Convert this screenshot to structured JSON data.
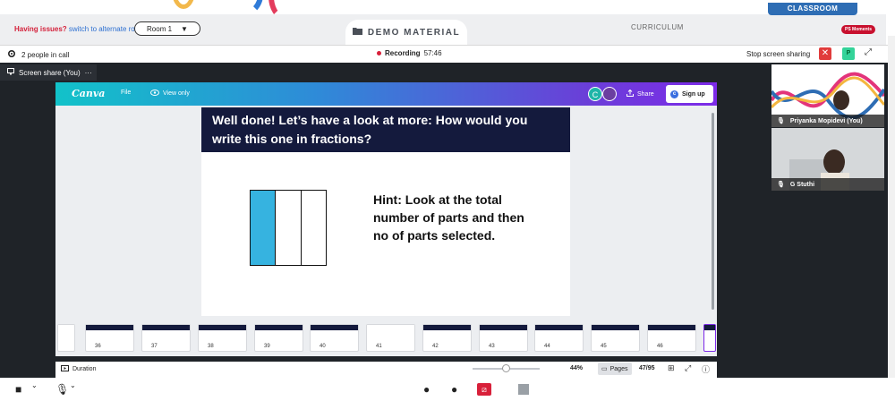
{
  "top": {
    "issues_label": "Having issues?",
    "issues_link": "switch to alternate room",
    "room_label": "Room 1",
    "room_caret": "▼",
    "demo_label": "DEMO MATERIAL",
    "curriculum_label": "CURRICULUM",
    "classroom_label": "CLASSROOM",
    "ps_badge": "PS Moments"
  },
  "callbar": {
    "people_count": "2 people in call",
    "recording_label": "Recording",
    "recording_time": "57:46",
    "stop_label": "Stop screen sharing",
    "p_badge": "P"
  },
  "screenshare_tab": "Screen share (You)",
  "canva": {
    "logo": "Canva",
    "file_label": "File",
    "view_only_label": "View only",
    "avatar_letter": "C",
    "share_label": "Share",
    "signup_label": "Sign up"
  },
  "slide": {
    "title": "Well done! Let’s have a look at more: How would you write this one in fractions?",
    "hint": "Hint: Look at the total number of parts and then no of parts selected.",
    "fraction_parts": 3,
    "fraction_selected": 1
  },
  "thumbnails": [
    "36",
    "37",
    "38",
    "39",
    "40",
    "41",
    "42",
    "43",
    "44",
    "45",
    "46"
  ],
  "footer": {
    "duration_label": "Duration",
    "zoom": "44%",
    "pages_label": "Pages",
    "page_count": "47/95"
  },
  "participants": [
    {
      "name": "Priyanka Mopidevi (You)"
    },
    {
      "name": "G Stuthi"
    }
  ],
  "colors": {
    "accent_blue": "#2e6db4",
    "canva_purple": "#7d2ae8",
    "slide_navy": "#141a3d",
    "fraction_fill": "#36b3e0",
    "record_red": "#d8203a"
  }
}
